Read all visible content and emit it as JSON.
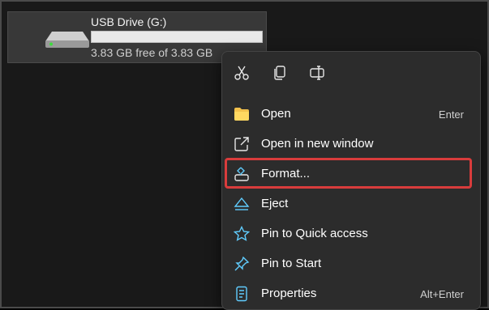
{
  "drive": {
    "name": "USB Drive (G:)",
    "free_text": "3.83 GB free of 3.83 GB",
    "used_fraction": 0.0
  },
  "menu": {
    "quick_actions": [
      {
        "icon": "scissors-icon",
        "name": "Cut"
      },
      {
        "icon": "copy-icon",
        "name": "Copy"
      },
      {
        "icon": "rename-icon",
        "name": "Rename"
      }
    ],
    "items": [
      {
        "icon": "folder-icon",
        "label": "Open",
        "shortcut": "Enter"
      },
      {
        "icon": "open-new-window-icon",
        "label": "Open in new window",
        "shortcut": ""
      },
      {
        "icon": "format-icon",
        "label": "Format...",
        "shortcut": ""
      },
      {
        "icon": "eject-icon",
        "label": "Eject",
        "shortcut": ""
      },
      {
        "icon": "star-icon",
        "label": "Pin to Quick access",
        "shortcut": ""
      },
      {
        "icon": "pin-icon",
        "label": "Pin to Start",
        "shortcut": ""
      },
      {
        "icon": "properties-icon",
        "label": "Properties",
        "shortcut": "Alt+Enter"
      }
    ]
  },
  "colors": {
    "highlight": "#d93c3c",
    "menu_bg": "#2c2c2c",
    "icon_accent": "#60cdff"
  }
}
